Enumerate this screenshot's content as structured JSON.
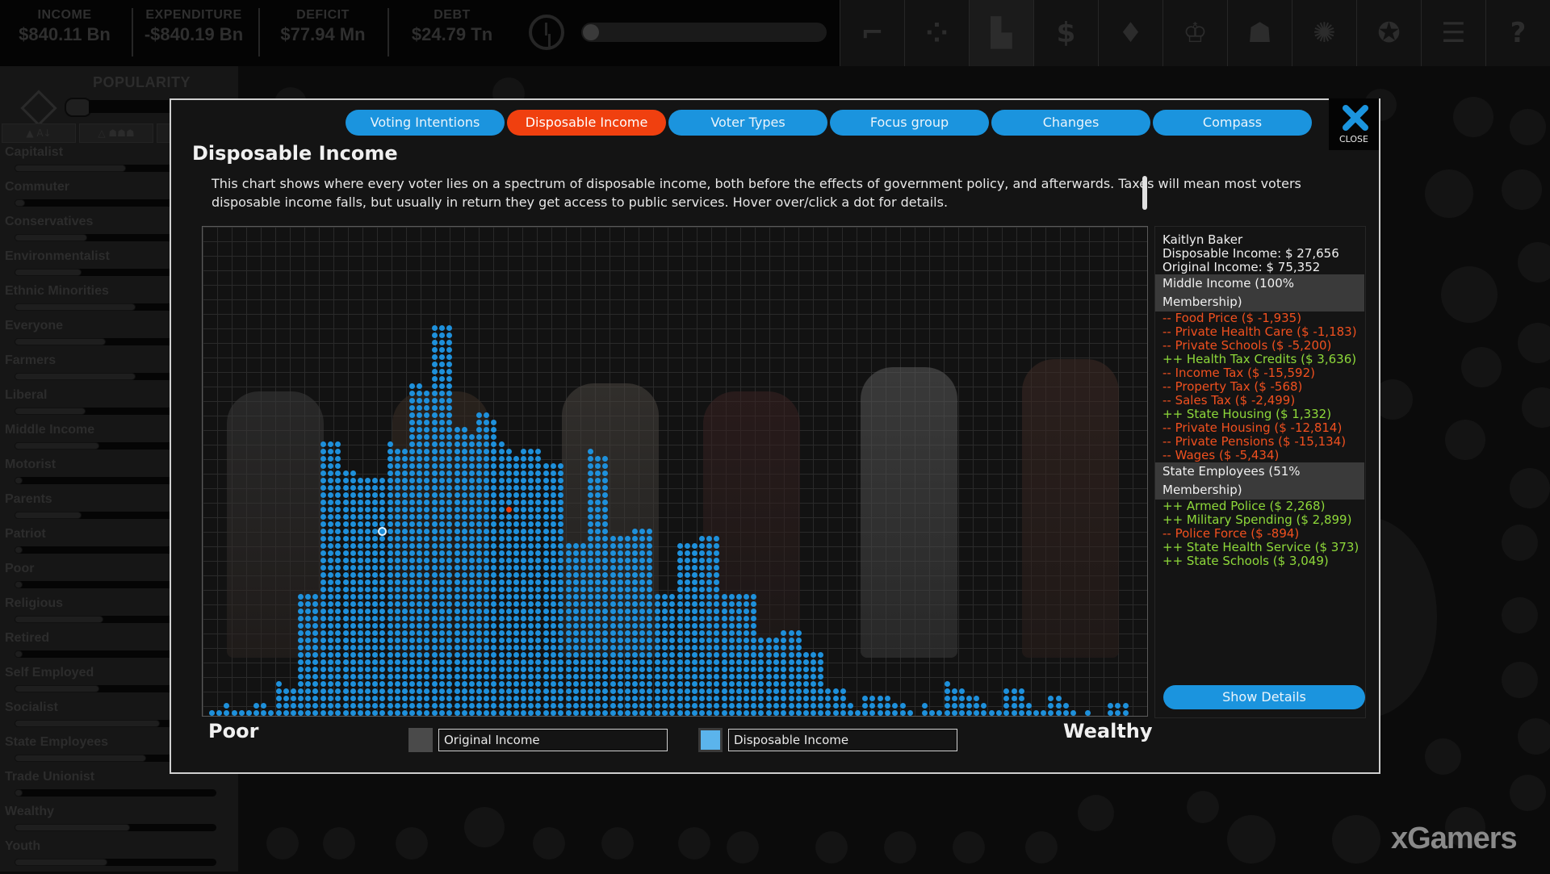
{
  "topbar": {
    "stats": [
      {
        "label": "INCOME",
        "value": "$840.11 Bn"
      },
      {
        "label": "EXPENDITURE",
        "value": "-$840.19 Bn"
      },
      {
        "label": "DEFICIT",
        "value": "$77.94 Mn"
      },
      {
        "label": "DEBT",
        "value": "$24.79 Tn"
      }
    ],
    "tools": [
      {
        "name": "gun-icon",
        "glyph": "⌐"
      },
      {
        "name": "circles-icon",
        "glyph": "⁘"
      },
      {
        "name": "bar-chart-icon",
        "glyph": "▙",
        "active": true
      },
      {
        "name": "dollar-icon",
        "glyph": "$"
      },
      {
        "name": "lightbulb-icon",
        "glyph": "♦"
      },
      {
        "name": "trophy-icon",
        "glyph": "♔"
      },
      {
        "name": "people-icon",
        "glyph": "☗"
      },
      {
        "name": "gear-icon",
        "glyph": "✺"
      },
      {
        "name": "ribbon-icon",
        "glyph": "✪"
      },
      {
        "name": "document-icon",
        "glyph": "☰"
      },
      {
        "name": "help-icon",
        "glyph": "?"
      }
    ]
  },
  "sidebar": {
    "title": "POPULARITY",
    "groups": [
      {
        "name": "Capitalist",
        "popularity": 0.55
      },
      {
        "name": "Commuter",
        "popularity": 0.05
      },
      {
        "name": "Conservatives",
        "popularity": 0.36
      },
      {
        "name": "Environmentalist",
        "popularity": 0.33
      },
      {
        "name": "Ethnic Minorities",
        "popularity": 0.6
      },
      {
        "name": "Everyone",
        "popularity": 0.45
      },
      {
        "name": "Farmers",
        "popularity": 0.6
      },
      {
        "name": "Liberal",
        "popularity": 0.35
      },
      {
        "name": "Middle Income",
        "popularity": 0.42
      },
      {
        "name": "Motorist",
        "popularity": 0.0
      },
      {
        "name": "Parents",
        "popularity": 0.33
      },
      {
        "name": "Patriot",
        "popularity": 0.0
      },
      {
        "name": "Poor",
        "popularity": 0.0
      },
      {
        "name": "Religious",
        "popularity": 0.44
      },
      {
        "name": "Retired",
        "popularity": 0.0
      },
      {
        "name": "Self Employed",
        "popularity": 0.42
      },
      {
        "name": "Socialist",
        "popularity": 0.72
      },
      {
        "name": "State Employees",
        "popularity": 0.65
      },
      {
        "name": "Trade Unionist",
        "popularity": 0.0
      },
      {
        "name": "Wealthy",
        "popularity": 0.57
      },
      {
        "name": "Youth",
        "popularity": 0.46
      }
    ]
  },
  "modal": {
    "tabs": [
      {
        "label": "Voting Intentions",
        "active": false
      },
      {
        "label": "Disposable Income",
        "active": true
      },
      {
        "label": "Voter Types",
        "active": false
      },
      {
        "label": "Focus group",
        "active": false
      },
      {
        "label": "Changes",
        "active": false
      },
      {
        "label": "Compass",
        "active": false
      }
    ],
    "close_label": "CLOSE",
    "title": "Disposable Income",
    "description": "This chart shows where every voter lies on a spectrum of disposable income, both before the effects of government policy, and afterwards. Taxes will mean most voters disposable income falls, but usually in return they get access to public services. Hover over/click a dot for details.",
    "axis_left": "Poor",
    "axis_right": "Wealthy",
    "legend": [
      {
        "label": "Original Income",
        "color": "#4a4a4a"
      },
      {
        "label": "Disposable Income",
        "color": "#5bb4ec"
      }
    ],
    "show_details_label": "Show Details",
    "voter": {
      "name": "Kaitlyn Baker",
      "disposable": "Disposable Income: $ 27,656",
      "original": "Original Income: $ 75,352",
      "groups": [
        {
          "header": "Middle Income (100% Membership)",
          "effects": [
            {
              "text": "-- Food Price ($ -1,935)",
              "sign": "neg"
            },
            {
              "text": "-- Private Health Care ($ -1,183)",
              "sign": "neg"
            },
            {
              "text": "-- Private Schools ($ -5,200)",
              "sign": "neg"
            },
            {
              "text": "++ Health Tax Credits ($ 3,636)",
              "sign": "pos"
            },
            {
              "text": "-- Income Tax ($ -15,592)",
              "sign": "neg"
            },
            {
              "text": "-- Property Tax ($ -568)",
              "sign": "neg"
            },
            {
              "text": "-- Sales Tax ($ -2,499)",
              "sign": "neg"
            },
            {
              "text": "++ State Housing ($ 1,332)",
              "sign": "pos"
            },
            {
              "text": "-- Private Housing ($ -12,814)",
              "sign": "neg"
            },
            {
              "text": "-- Private Pensions ($ -15,134)",
              "sign": "neg"
            },
            {
              "text": "-- Wages ($ -5,434)",
              "sign": "neg"
            }
          ]
        },
        {
          "header": "State Employees (51% Membership)",
          "effects": [
            {
              "text": "++ Armed Police ($ 2,268)",
              "sign": "pos"
            },
            {
              "text": "++ Military Spending ($ 2,899)",
              "sign": "pos"
            },
            {
              "text": "-- Police Force ($ -894)",
              "sign": "neg"
            },
            {
              "text": "++ State Health Service ($ 373)",
              "sign": "pos"
            },
            {
              "text": "++ State Schools ($ 3,049)",
              "sign": "pos"
            }
          ]
        }
      ]
    }
  },
  "chart_data": {
    "type": "scatter",
    "title": "Disposable Income",
    "xlabel_left": "Poor",
    "xlabel_right": "Wealthy",
    "series": [
      {
        "name": "Disposable Income",
        "color": "#1e90db"
      }
    ],
    "column_counts": [
      1,
      1,
      2,
      1,
      1,
      1,
      2,
      2,
      1,
      5,
      4,
      4,
      17,
      17,
      17,
      38,
      38,
      38,
      34,
      34,
      33,
      33,
      33,
      33,
      38,
      37,
      37,
      46,
      46,
      45,
      54,
      54,
      54,
      40,
      40,
      39,
      42,
      42,
      41,
      38,
      37,
      36,
      37,
      37,
      37,
      35,
      35,
      35,
      24,
      24,
      24,
      37,
      36,
      36,
      25,
      25,
      25,
      26,
      26,
      26,
      17,
      17,
      17,
      24,
      24,
      24,
      25,
      25,
      25,
      17,
      17,
      17,
      17,
      17,
      11,
      11,
      11,
      12,
      12,
      12,
      9,
      9,
      9,
      4,
      4,
      4,
      2,
      1,
      3,
      3,
      3,
      3,
      2,
      2,
      1,
      0,
      2,
      1,
      1,
      5,
      4,
      4,
      3,
      3,
      2,
      1,
      1,
      4,
      4,
      4,
      2,
      1,
      1,
      3,
      3,
      2,
      1,
      0,
      1,
      0,
      0,
      2,
      2,
      2
    ],
    "selected_voter": {
      "column": 23,
      "row": 25
    },
    "highlight_voter": {
      "column": 40,
      "row": 28
    }
  },
  "watermark": "xGamers"
}
